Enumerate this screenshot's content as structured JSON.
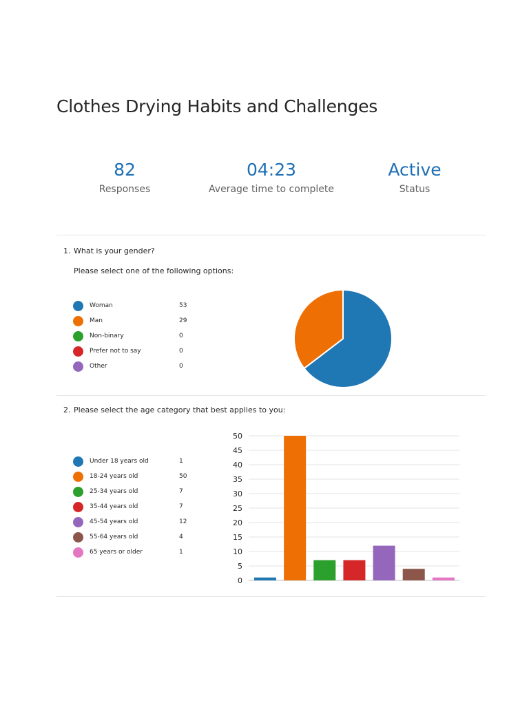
{
  "title": "Clothes Drying Habits and Challenges",
  "stats": [
    {
      "value": "82",
      "label": "Responses"
    },
    {
      "value": "04:23",
      "label": "Average time to complete"
    },
    {
      "value": "Active",
      "label": "Status"
    }
  ],
  "colors": {
    "accent": "#1f6fb5",
    "series": [
      "#1f77b4",
      "#ee6f04",
      "#2ca02c",
      "#d62728",
      "#9467bd",
      "#8c564b",
      "#e377c2"
    ]
  },
  "questions": [
    {
      "number": "1.",
      "text": "What is your gender?",
      "instruction": "Please select one of the following options:"
    },
    {
      "number": "2.",
      "text": "Please select the age category that best applies to you:"
    }
  ],
  "chart_data": [
    {
      "type": "pie",
      "categories": [
        "Woman",
        "Man",
        "Non-binary",
        "Prefer not to say",
        "Other"
      ],
      "values": [
        53,
        29,
        0,
        0,
        0
      ]
    },
    {
      "type": "bar",
      "categories": [
        "Under 18 years old",
        "18-24 years old",
        "25-34 years old",
        "35-44 years old",
        "45-54 years old",
        "55-64 years old",
        "65 years or older"
      ],
      "values": [
        1,
        50,
        7,
        7,
        12,
        4,
        1
      ],
      "ylim": [
        0,
        50
      ],
      "yticks": [
        0,
        5,
        10,
        15,
        20,
        25,
        30,
        35,
        40,
        45,
        50
      ],
      "grid": true
    }
  ]
}
